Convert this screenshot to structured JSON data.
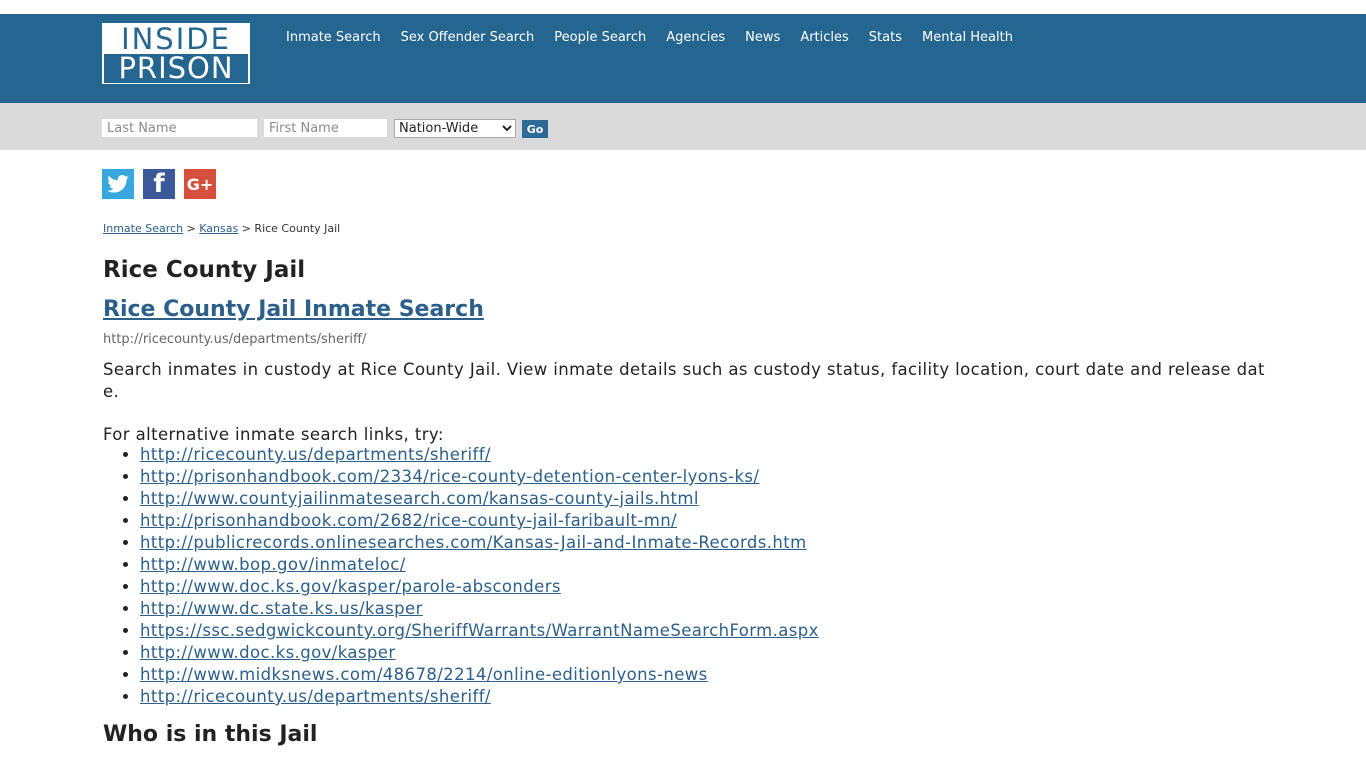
{
  "logo": {
    "line1": "INSIDE",
    "line2": "PRISON"
  },
  "nav": [
    "Inmate Search",
    "Sex Offender Search",
    "People Search",
    "Agencies",
    "News",
    "Articles",
    "Stats",
    "Mental Health"
  ],
  "search": {
    "last_placeholder": "Last Name",
    "first_placeholder": "First Name",
    "scope_selected": "Nation-Wide",
    "go_label": "Go"
  },
  "social": {
    "twitter_glyph": "🐦",
    "facebook_glyph": "f",
    "google_glyph": "G+"
  },
  "breadcrumb": {
    "crumb1": "Inmate Search",
    "sep": ">",
    "crumb2": "Kansas",
    "current": "Rice County Jail"
  },
  "page_title": "Rice County Jail",
  "search_heading": "Rice County Jail Inmate Search",
  "source_url": "http://ricecounty.us/departments/sheriff/",
  "description": "Search inmates in custody at Rice County Jail. View inmate details such as custody status, facility location, court date and release date.",
  "alt_intro": "For alternative inmate search links, try:",
  "links": [
    "http://ricecounty.us/departments/sheriff/",
    "http://prisonhandbook.com/2334/rice-county-detention-center-lyons-ks/",
    "http://www.countyjailinmatesearch.com/kansas-county-jails.html",
    "http://prisonhandbook.com/2682/rice-county-jail-faribault-mn/",
    "http://publicrecords.onlinesearches.com/Kansas-Jail-and-Inmate-Records.htm",
    "http://www.bop.gov/inmateloc/",
    "http://www.doc.ks.gov/kasper/parole-absconders",
    "http://www.dc.state.ks.us/kasper",
    "https://ssc.sedgwickcounty.org/SheriffWarrants/WarrantNameSearchForm.aspx",
    "http://www.doc.ks.gov/kasper",
    "http://www.midksnews.com/48678/2214/online-editionlyons-news",
    "http://ricecounty.us/departments/sheriff/"
  ],
  "who_heading": "Who is in this Jail"
}
